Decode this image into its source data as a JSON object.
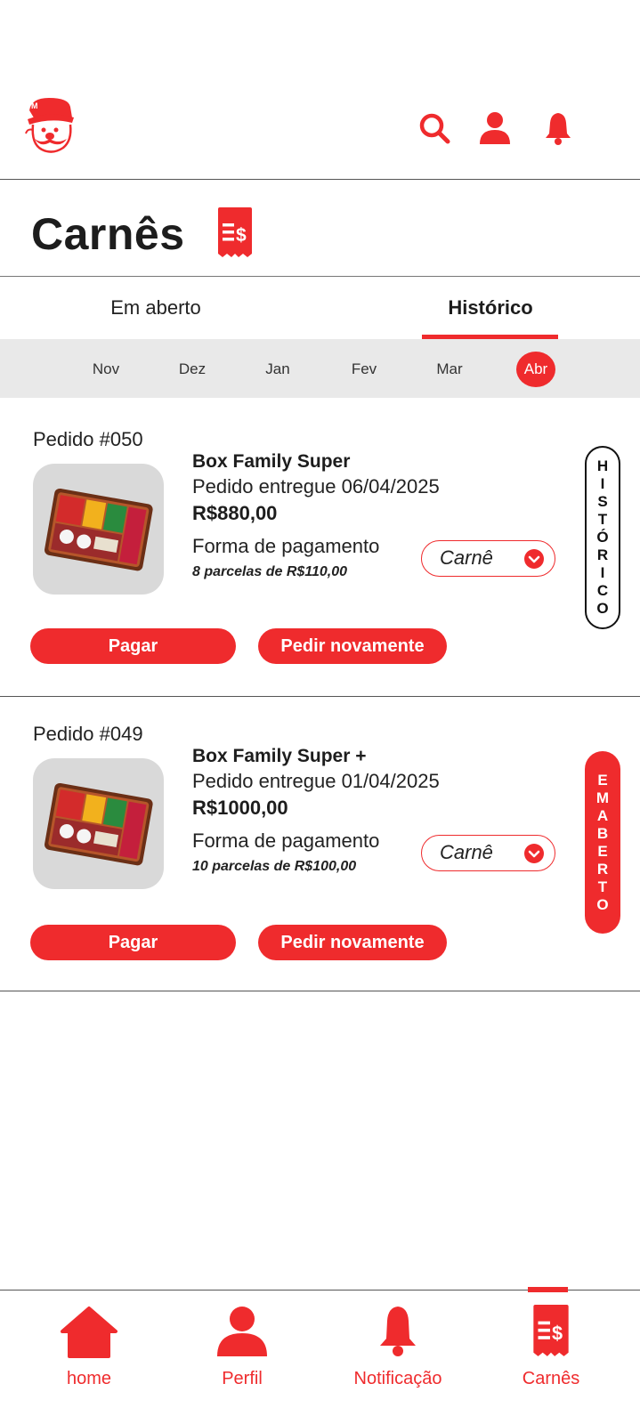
{
  "header": {
    "logo_icon": "mustached-chef-mascot-logo",
    "icons": [
      "search-icon",
      "user-icon",
      "bell-icon"
    ],
    "accent_color": "#ef2b2d"
  },
  "page": {
    "title": "Carnês",
    "title_icon": "receipt-dollar-icon"
  },
  "tabs": [
    {
      "label": "Em aberto",
      "active": false
    },
    {
      "label": "Histórico",
      "active": true
    }
  ],
  "months": [
    {
      "label": "Nov",
      "active": false
    },
    {
      "label": "Dez",
      "active": false
    },
    {
      "label": "Jan",
      "active": false
    },
    {
      "label": "Fev",
      "active": false
    },
    {
      "label": "Mar",
      "active": false
    },
    {
      "label": "Abr",
      "active": true
    }
  ],
  "orders": [
    {
      "number": "Pedido #050",
      "product": "Box Family Super",
      "status": "Pedido entregue 06/04/2025",
      "price": "R$880,00",
      "payment_label": "Forma de pagamento",
      "payment_method": "Carnê",
      "installments": "8 parcelas de R$110,00",
      "pay_button": "Pagar",
      "reorder_button": "Pedir novamente",
      "badge": [
        "H",
        "I",
        "S",
        "T",
        "Ó",
        "R",
        "I",
        "C",
        "O"
      ]
    },
    {
      "number": "Pedido #049",
      "product": "Box Family Super +",
      "status": "Pedido entregue 01/04/2025",
      "price": "R$1000,00",
      "payment_label": "Forma de pagamento",
      "payment_method": "Carnê",
      "installments": "10 parcelas de R$100,00",
      "pay_button": "Pagar",
      "reorder_button": "Pedir novamente",
      "badge": [
        "E",
        "M",
        "A",
        "B",
        "E",
        "R",
        "T",
        "O"
      ]
    }
  ],
  "bottom_nav": [
    {
      "label": "home",
      "icon": "home-icon"
    },
    {
      "label": "Perfil",
      "icon": "user-icon"
    },
    {
      "label": "Notificação",
      "icon": "bell-icon"
    },
    {
      "label": "Carnês",
      "icon": "receipt-dollar-icon",
      "active": true
    }
  ]
}
